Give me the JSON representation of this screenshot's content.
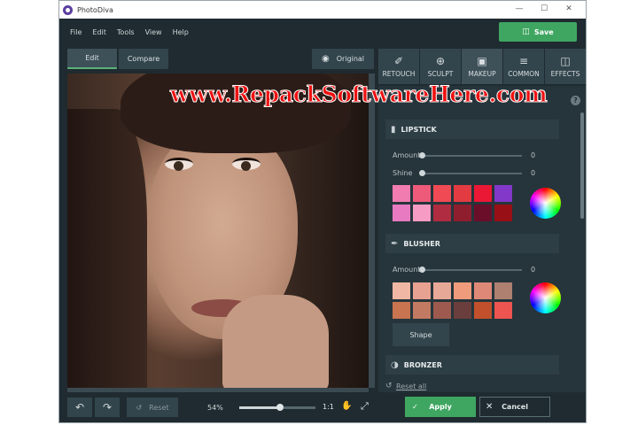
{
  "window": {
    "title": "PhotoDiva",
    "controls": [
      "—",
      "☐",
      "✕"
    ]
  },
  "menu": [
    "File",
    "Edit",
    "Tools",
    "View",
    "Help"
  ],
  "toolbar": {
    "save_label": "Save"
  },
  "modes": {
    "edit": "Edit",
    "compare": "Compare",
    "original": "Original"
  },
  "watermark": "www.RepackSoftwareHere.com",
  "tools": [
    {
      "label": "RETOUCH",
      "icon": "brush-icon"
    },
    {
      "label": "SCULPT",
      "icon": "sculpt-icon"
    },
    {
      "label": "MAKEUP",
      "icon": "makeup-icon"
    },
    {
      "label": "COMMON",
      "icon": "sliders-icon"
    },
    {
      "label": "EFFECTS",
      "icon": "effects-icon"
    }
  ],
  "active_tool": "MAKEUP",
  "panel": {
    "lipstick": {
      "title": "LIPSTICK",
      "amount_label": "Amount",
      "amount_value": "0",
      "shine_label": "Shine",
      "shine_value": "0",
      "colors": [
        "#f07cb0",
        "#ee5a7a",
        "#f04a55",
        "#e23c42",
        "#ea1835",
        "#8238c8",
        "#e87ac2",
        "#f69cc4",
        "#b02c40",
        "#8e1e2e",
        "#6a0e2a",
        "#980f16"
      ]
    },
    "blusher": {
      "title": "BLUSHER",
      "amount_label": "Amount",
      "amount_value": "0",
      "colors": [
        "#f0b8a4",
        "#e8a292",
        "#e8a898",
        "#f09c7c",
        "#de8878",
        "#ae8070",
        "#c87450",
        "#c27a62",
        "#9e5a4e",
        "#6a3e3c",
        "#c2502c",
        "#ee5450"
      ],
      "shape_label": "Shape"
    },
    "bronzer": {
      "title": "BRONZER"
    },
    "reset_all": "Reset all"
  },
  "bottom": {
    "reset_label": "Reset",
    "zoom": "54%",
    "zoom_fraction": 0.54,
    "one_to_one": "1:1",
    "apply_label": "Apply",
    "cancel_label": "Cancel"
  }
}
